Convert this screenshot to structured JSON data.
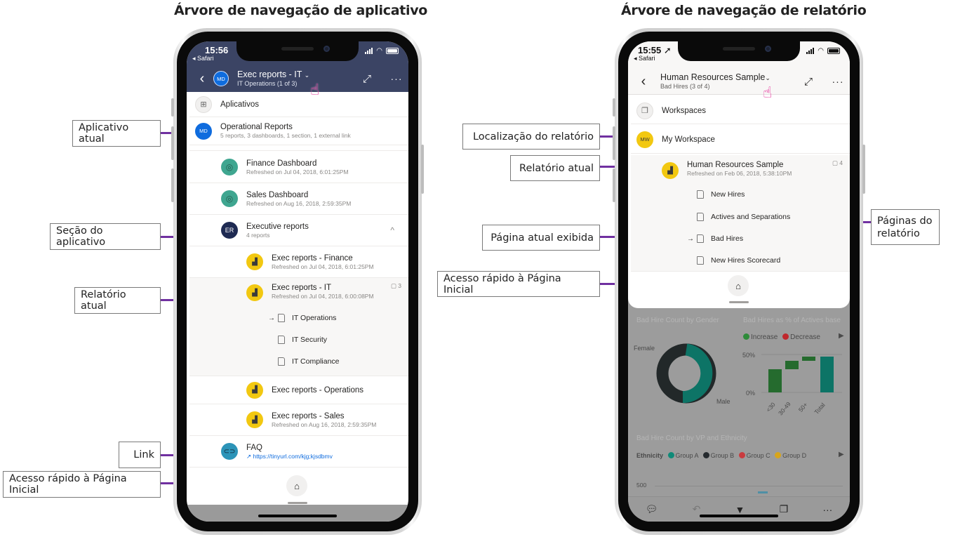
{
  "titles": {
    "left": "Árvore de navegação de aplicativo",
    "right": "Árvore de navegação de relatório"
  },
  "left_callouts": {
    "current_app": "Aplicativo atual",
    "app_section": "Seção do aplicativo",
    "current_report": "Relatório atual",
    "link": "Link",
    "home_access": "Acesso rápido à Página Inicial"
  },
  "right_callouts": {
    "report_location": "Localização do relatório",
    "current_report": "Relatório atual",
    "current_page": "Página atual exibida",
    "home_access": "Acesso rápido à Página Inicial",
    "report_pages": "Páginas do relatório"
  },
  "app_phone": {
    "status": {
      "time": "15:56",
      "back_app": "◂ Safari"
    },
    "header": {
      "back_icon": "chevron-left",
      "avatar": "MD",
      "title": "Exec reports - IT",
      "dropdown_icon": "⌄",
      "subtitle": "IT Operations (1 of 3)",
      "expand_icon": "⤢",
      "more_icon": "···",
      "bg_color": "#3b4464"
    },
    "apps_row": {
      "icon": "⊞",
      "label": "Aplicativos"
    },
    "current_app": {
      "avatar": "MD",
      "name": "Operational Reports",
      "meta": "5 reports, 3 dashboards, 1 section, 1 external link"
    },
    "items": [
      {
        "icon": "dashboard",
        "name": "Finance Dashboard",
        "meta": "Refreshed on Jul 04, 2018, 6:01:25PM"
      },
      {
        "icon": "dashboard",
        "name": "Sales Dashboard",
        "meta": "Refreshed on Aug 16, 2018, 2:59:35PM"
      }
    ],
    "section": {
      "avatar": "ER",
      "name": "Executive reports",
      "meta": "4 reports",
      "chevron": "^"
    },
    "reports": [
      {
        "name": "Exec reports - Finance",
        "meta": "Refreshed on Jul 04, 2018, 6:01:25PM"
      },
      {
        "name": "Exec reports - IT",
        "meta": "Refreshed on Jul 04, 2018, 6:00:08PM",
        "page_count": "3"
      },
      {
        "name": "Exec reports - Operations",
        "meta": ""
      },
      {
        "name": "Exec reports - Sales",
        "meta": "Refreshed on Aug 16, 2018, 2:59:35PM"
      }
    ],
    "pages": [
      {
        "label": "IT Operations",
        "current": true,
        "arrow": "→"
      },
      {
        "label": "IT Security",
        "current": false,
        "arrow": ""
      },
      {
        "label": "IT Compliance",
        "current": false,
        "arrow": ""
      }
    ],
    "link": {
      "name": "FAQ",
      "url": "https://tinyurl.com/kjg;kjsdbmv"
    },
    "home_icon": "⌂"
  },
  "report_phone": {
    "status": {
      "time": "15:55 ➚",
      "back_app": "◂ Safari"
    },
    "header": {
      "title": "Human Resources Sample",
      "dropdown_icon": "⌄",
      "subtitle": "Bad Hires (3 of 4)",
      "expand_icon": "⤢",
      "more_icon": "···"
    },
    "workspaces_row": {
      "label": "Workspaces"
    },
    "workspace": {
      "avatar": "MW",
      "name": "My Workspace"
    },
    "report": {
      "name": "Human Resources Sample",
      "meta": "Refreshed on Feb 06, 2018, 5:38:10PM",
      "page_count": "4"
    },
    "pages": [
      {
        "label": "New Hires",
        "current": false,
        "arrow": ""
      },
      {
        "label": "Actives and Separations",
        "current": false,
        "arrow": ""
      },
      {
        "label": "Bad Hires",
        "current": true,
        "arrow": "→"
      },
      {
        "label": "New Hires Scorecard",
        "current": false,
        "arrow": ""
      }
    ],
    "home_icon": "⌂",
    "background_report": {
      "donut_title": "Bad Hire Count by Gender",
      "donut_labels": [
        "Female",
        "Male"
      ],
      "waterfall_title": "Bad Hires as % of Actives base",
      "legend": [
        {
          "label": "Increase",
          "color": "#2e8b3a"
        },
        {
          "label": "Decrease",
          "color": "#c0282d"
        }
      ],
      "waterfall_y_ticks": [
        "50%",
        "0%"
      ],
      "waterfall_x": [
        "<30",
        "30-49",
        "50+",
        "Total"
      ],
      "bar_title": "Bad Hire Count by VP and Ethnicity",
      "ethnicity_label": "Ethnicity",
      "ethnicity_legend": [
        {
          "label": "Group A",
          "color": "#0f8a78"
        },
        {
          "label": "Group B",
          "color": "#252a2e"
        },
        {
          "label": "Group C",
          "color": "#c93b3f"
        },
        {
          "label": "Group D",
          "color": "#d7a51c"
        }
      ],
      "bar_y_tick": "500"
    },
    "toolbar": [
      "comment",
      "undo",
      "filter",
      "pages",
      "more"
    ]
  }
}
